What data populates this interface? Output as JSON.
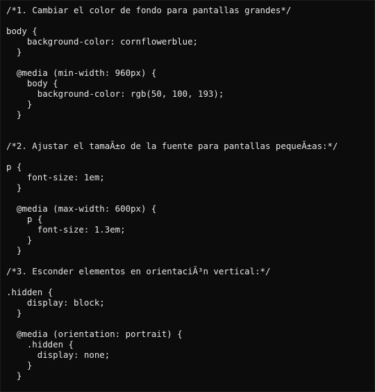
{
  "code": {
    "lines": [
      "/*1. Cambiar el color de fondo para pantallas grandes*/",
      "",
      "body {",
      "    background-color: cornflowerblue;",
      "  }",
      "",
      "  @media (min-width: 960px) {",
      "    body {",
      "      background-color: rgb(50, 100, 193);",
      "    }",
      "  }",
      "",
      "",
      "/*2. Ajustar el tamaÃ±o de la fuente para pantallas pequeÃ±as:*/",
      "",
      "p {",
      "    font-size: 1em;",
      "  }",
      "",
      "  @media (max-width: 600px) {",
      "    p {",
      "      font-size: 1.3em;",
      "    }",
      "  }",
      "",
      "/*3. Esconder elementos en orientaciÃ³n vertical:*/",
      "",
      ".hidden {",
      "    display: block;",
      "  }",
      "",
      "  @media (orientation: portrait) {",
      "    .hidden {",
      "      display: none;",
      "    }",
      "  }"
    ]
  }
}
